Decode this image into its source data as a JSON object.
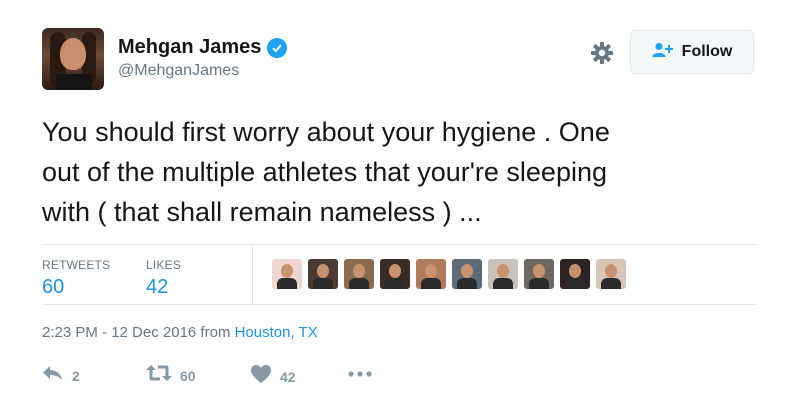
{
  "user": {
    "display_name": "Mehgan James",
    "handle": "@MehganJames",
    "verified": true
  },
  "header": {
    "follow_label": "Follow"
  },
  "tweet": {
    "text": "You should first worry about your hygiene . One\nout of the multiple athletes that your're sleeping\nwith ( that shall remain nameless ) ..."
  },
  "stats": {
    "retweets_label": "RETWEETS",
    "retweets_value": "60",
    "likes_label": "LIKES",
    "likes_value": "42"
  },
  "likers": [
    {
      "icon": "liker-avatar",
      "bg": "#f0d6d0"
    },
    {
      "icon": "liker-avatar",
      "bg": "#4a3b32"
    },
    {
      "icon": "liker-avatar",
      "bg": "#8b6a4f"
    },
    {
      "icon": "liker-avatar",
      "bg": "#3a2b24"
    },
    {
      "icon": "liker-avatar",
      "bg": "#b07a5c"
    },
    {
      "icon": "liker-avatar",
      "bg": "#5d6b78"
    },
    {
      "icon": "liker-avatar",
      "bg": "#c8c2bb"
    },
    {
      "icon": "liker-avatar",
      "bg": "#6e6863"
    },
    {
      "icon": "liker-avatar",
      "bg": "#2d2422"
    },
    {
      "icon": "liker-avatar",
      "bg": "#d8c7b8"
    }
  ],
  "meta": {
    "time": "2:23 PM - 12 Dec 2016 from ",
    "location": "Houston, TX"
  },
  "actions": {
    "reply_count": "2",
    "retweet_count": "60",
    "like_count": "42"
  },
  "colors": {
    "accent": "#1da1f2",
    "link": "#1b95e0",
    "muted": "#657786",
    "icon_gray": "#8899a6"
  }
}
